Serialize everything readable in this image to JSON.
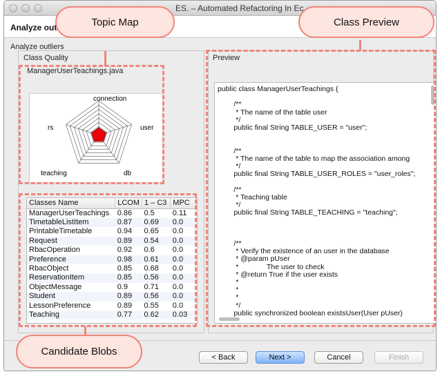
{
  "window": {
    "title": "ES. – Automated Refactoring In Ec"
  },
  "wizard": {
    "title": "Analyze outl"
  },
  "groups": {
    "analyze_outliers": "Analyze outliers",
    "class_quality": "Class Quality",
    "preview": "Preview"
  },
  "radar": {
    "file_name": "ManagerUserTeachings.java",
    "axes": [
      "connection",
      "user",
      "db",
      "teaching",
      "rs"
    ],
    "fill_color": "#e8000b"
  },
  "table": {
    "columns": [
      "Classes Name",
      "LCOM",
      "1 – C3",
      "MPC"
    ],
    "rows": [
      [
        "ManagerUserTeachings",
        "0.86",
        "0.5",
        "0.11"
      ],
      [
        "TimetableListItem",
        "0.87",
        "0.69",
        "0.0"
      ],
      [
        "PrintableTimetable",
        "0.94",
        "0.65",
        "0.0"
      ],
      [
        "Request",
        "0.89",
        "0.54",
        "0.0"
      ],
      [
        "RbacOperation",
        "0.92",
        "0.6",
        "0.0"
      ],
      [
        "Preference",
        "0.98",
        "0.61",
        "0.0"
      ],
      [
        "RbacObject",
        "0.85",
        "0.68",
        "0.0"
      ],
      [
        "ReservationItem",
        "0.85",
        "0.56",
        "0.0"
      ],
      [
        "ObjectMessage",
        "0.9",
        "0.71",
        "0.0"
      ],
      [
        "Student",
        "0.89",
        "0.56",
        "0.0"
      ],
      [
        "LessonPreference",
        "0.89",
        "0.55",
        "0.0"
      ],
      [
        "Teaching",
        "0.77",
        "0.62",
        "0.03"
      ]
    ]
  },
  "code": {
    "lines": [
      "public class ManagerUserTeachings {",
      "",
      "        /**",
      "         * The name of the table user",
      "         */",
      "        public final String TABLE_USER = \"user\";",
      "",
      "",
      "        /**",
      "         * The name of the table to map the association among",
      "         */",
      "        public final String TABLE_USER_ROLES = \"user_roles\";",
      "",
      "        /**",
      "         * Teaching table",
      "         */",
      "        public final String TABLE_TEACHING = \"teaching\";",
      "",
      "",
      "",
      "        /**",
      "         * Verify the existence of an user in the database",
      "         * @param pUser",
      "         *              The user to check",
      "         * @return True if the user exists",
      "         *",
      "         *",
      "         *",
      "         */",
      "        public synchronized boolean existsUser(User pUser)"
    ]
  },
  "callouts": {
    "topic_map": "Topic Map",
    "class_preview": "Class Preview",
    "candidate_blobs": "Candidate Blobs"
  },
  "buttons": {
    "back": "< Back",
    "next": "Next >",
    "cancel": "Cancel",
    "finish": "Finish"
  },
  "colors": {
    "annotation": "#f0857a",
    "callout_fill": "#fde5e0",
    "primary_button": "#7fb2f5"
  }
}
